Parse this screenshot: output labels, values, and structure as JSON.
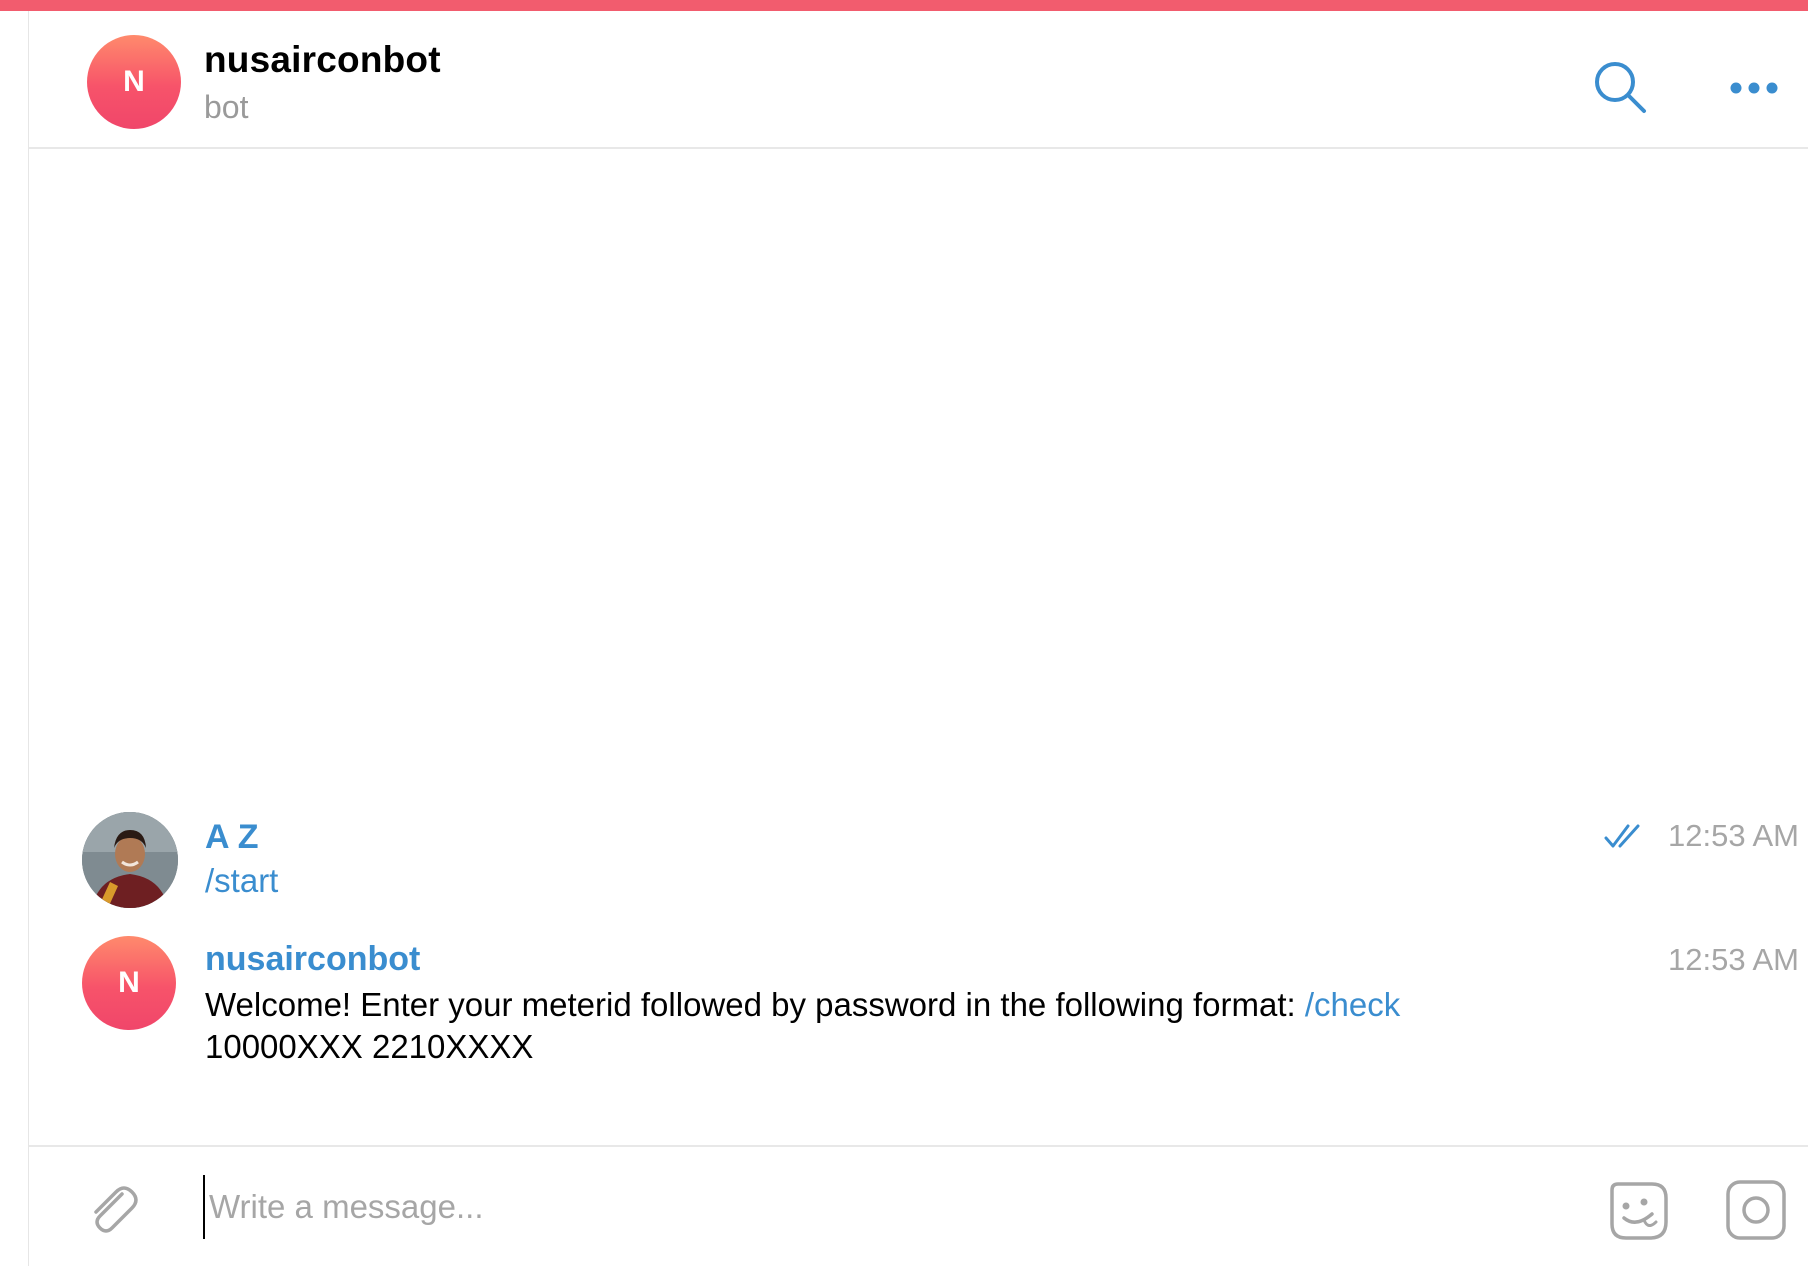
{
  "header": {
    "avatar_initial": "N",
    "title": "nusairconbot",
    "subtitle": "bot"
  },
  "messages": [
    {
      "sender": "A Z",
      "text": "/start",
      "time": "12:53 AM",
      "read_icon": "double-check-icon"
    },
    {
      "sender": "nusairconbot",
      "avatar_initial": "N",
      "text_before": "Welcome! Enter your meterid followed by password in the following format: ",
      "command": "/check",
      "text_after": "10000XXX 2210XXXX",
      "time": "12:53 AM"
    }
  ],
  "composer": {
    "placeholder": "Write a message...",
    "value": ""
  },
  "colors": {
    "accent": "#3a8dcf",
    "top_bar": "#f25c6e",
    "bot_avatar": "#f7536a",
    "time_text": "#a6a6a6"
  },
  "icons": [
    "search-icon",
    "more-icon",
    "double-check-icon",
    "paperclip-icon",
    "sticker-icon",
    "camera-icon"
  ]
}
